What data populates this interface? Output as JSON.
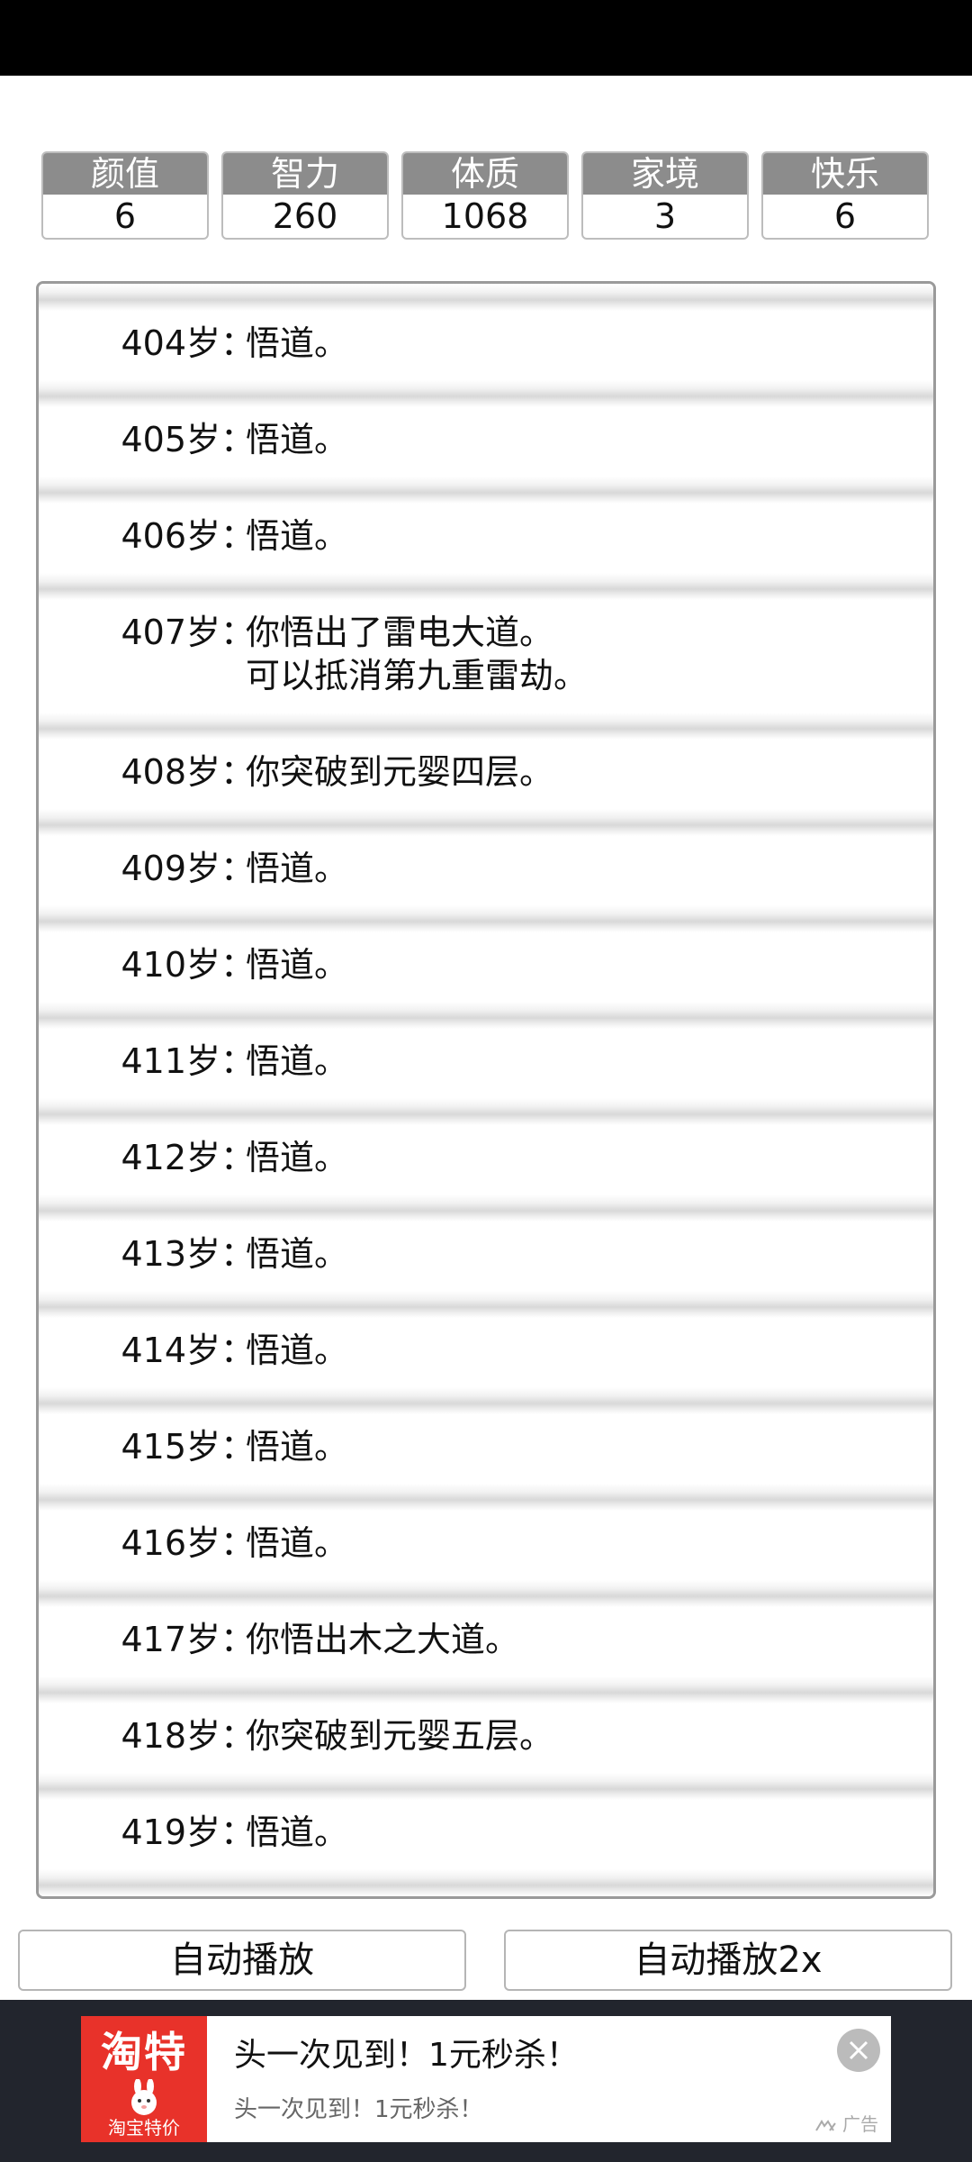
{
  "stats": [
    {
      "label": "颜值",
      "value": "6"
    },
    {
      "label": "智力",
      "value": "260"
    },
    {
      "label": "体质",
      "value": "1068"
    },
    {
      "label": "家境",
      "value": "3"
    },
    {
      "label": "快乐",
      "value": "6"
    }
  ],
  "log": [
    {
      "age": "404岁",
      "event": "悟道。"
    },
    {
      "age": "405岁",
      "event": "悟道。"
    },
    {
      "age": "406岁",
      "event": "悟道。"
    },
    {
      "age": "407岁",
      "event": "你悟出了雷电大道。\n可以抵消第九重雷劫。"
    },
    {
      "age": "408岁",
      "event": "你突破到元婴四层。"
    },
    {
      "age": "409岁",
      "event": "悟道。"
    },
    {
      "age": "410岁",
      "event": "悟道。"
    },
    {
      "age": "411岁",
      "event": "悟道。"
    },
    {
      "age": "412岁",
      "event": "悟道。"
    },
    {
      "age": "413岁",
      "event": "悟道。"
    },
    {
      "age": "414岁",
      "event": "悟道。"
    },
    {
      "age": "415岁",
      "event": "悟道。"
    },
    {
      "age": "416岁",
      "event": "悟道。"
    },
    {
      "age": "417岁",
      "event": "你悟出木之大道。"
    },
    {
      "age": "418岁",
      "event": "你突破到元婴五层。"
    },
    {
      "age": "419岁",
      "event": "悟道。"
    }
  ],
  "log_separator": "：",
  "buttons": {
    "auto": "自动播放",
    "auto2x": "自动播放2x"
  },
  "ad": {
    "logo": "淘特",
    "logo_sub": "淘宝特价",
    "title": "头一次见到！1元秒杀！",
    "subtitle": "头一次见到！1元秒杀！",
    "tag": "广告",
    "close_icon": "close-icon",
    "brand_color": "#e8322a"
  }
}
